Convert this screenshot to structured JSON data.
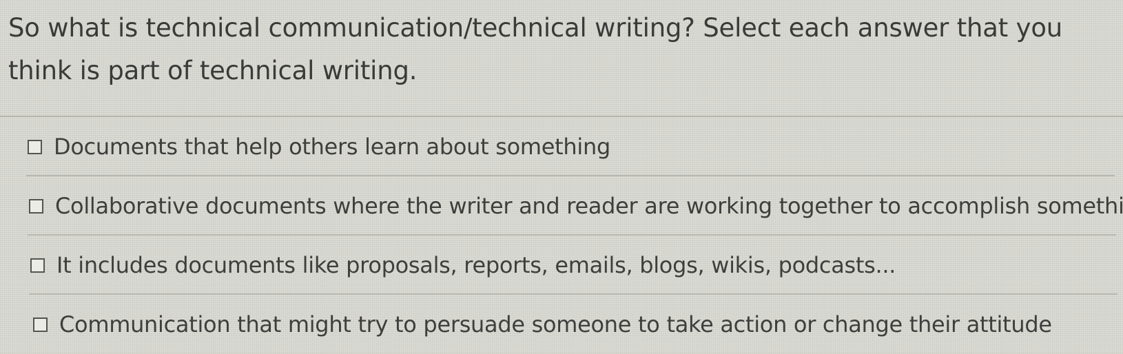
{
  "question": {
    "text": "So what is technical communication/technical writing? Select each answer that you think is part of technical writing."
  },
  "answers": [
    {
      "label": "Documents that help others learn about something",
      "checked": false
    },
    {
      "label": "Collaborative documents where the writer and reader are working together to accomplish something",
      "checked": false
    },
    {
      "label": "It includes documents like proposals, reports, emails, blogs, wikis, podcasts...",
      "checked": false
    },
    {
      "label": "Communication that might try to persuade someone to take action or change their attitude",
      "checked": false
    }
  ]
}
